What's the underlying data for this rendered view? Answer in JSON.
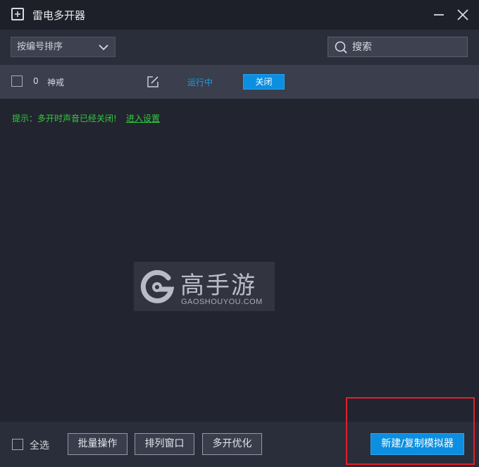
{
  "window": {
    "title": "雷电多开器",
    "icon": "add-window-icon"
  },
  "toolbar": {
    "sort_selected": "按编号排序",
    "search_placeholder": "搜索"
  },
  "instances": [
    {
      "index": "0",
      "name": "神戒",
      "status": "运行中",
      "action_label": "关闭"
    }
  ],
  "hint": {
    "text": "提示：多开时声音已经关闭!",
    "link": "进入设置"
  },
  "watermark": {
    "brand": "高手游",
    "url": "GAOSHOUYOU.COM"
  },
  "footer": {
    "select_all": "全选",
    "batch": "批量操作",
    "arrange": "排列窗口",
    "optimize": "多开优化",
    "new_copy": "新建/复制模拟器"
  },
  "colors": {
    "accent": "#0c8fe0",
    "status_running": "#1a9de3",
    "hint_green": "#2fcb3e",
    "highlight": "#e0202a"
  }
}
